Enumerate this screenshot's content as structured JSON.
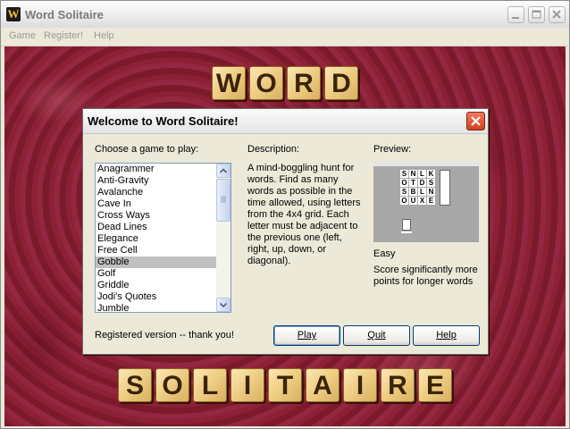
{
  "window": {
    "title": "Word Solitaire",
    "icon_letter": "W",
    "icon": "word-solitaire-app-icon",
    "controls": [
      "minimize-icon",
      "maximize-icon",
      "close-icon"
    ]
  },
  "menubar": {
    "items": [
      {
        "label": "Game"
      },
      {
        "label": "Register!"
      },
      {
        "label": "Help"
      }
    ]
  },
  "banner": {
    "top_letters": [
      "W",
      "O",
      "R",
      "D"
    ],
    "bottom_letters": [
      "S",
      "O",
      "L",
      "I",
      "T",
      "A",
      "I",
      "R",
      "E"
    ]
  },
  "dialog": {
    "title": "Welcome to Word Solitaire!",
    "choose_label": "Choose a game to play:",
    "games": [
      "Anagrammer",
      "Anti-Gravity",
      "Avalanche",
      "Cave In",
      "Cross Ways",
      "Dead Lines",
      "Elegance",
      "Free Cell",
      "Gobble",
      "Golf",
      "Griddle",
      "Jodi's Quotes",
      "Jumble"
    ],
    "selected_game": "Gobble",
    "description_label": "Description:",
    "description": "A mind-boggling hunt for words.  Find as many words as possible in the time allowed, using letters from the 4x4 grid. Each letter must be adjacent to the previous one (left, right, up, down, or diagonal).",
    "preview_label": "Preview:",
    "preview_grid": [
      "S",
      "N",
      "L",
      "K",
      "O",
      "T",
      "D",
      "S",
      "S",
      "B",
      "L",
      "N",
      "O",
      "U",
      "X",
      "E"
    ],
    "difficulty": "Easy",
    "scoring": "Score significantly more points for longer words",
    "registration": "Registered version -- thank you!",
    "buttons": {
      "play": "Play",
      "quit": "Quit",
      "help": "Help"
    }
  },
  "colors": {
    "felt": "#86202f",
    "tile": "#efcf86",
    "selection": "#c0c0c0"
  }
}
